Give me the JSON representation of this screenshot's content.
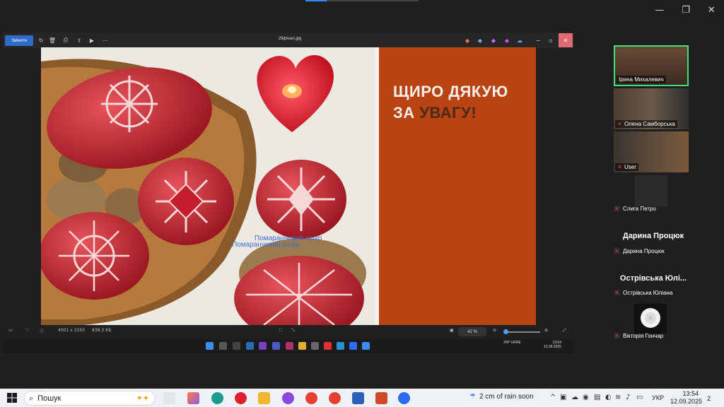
{
  "window_controls": {
    "minimize": "—",
    "restore": "❐",
    "close": "✕"
  },
  "photos_app": {
    "open_button": "Змінити",
    "file_name": "29фінал.jpg",
    "bottom": {
      "dimensions": "4001 x 2250",
      "file_size": "838.3 КБ",
      "zoom": "42 %"
    },
    "inner_taskbar": {
      "lang": "УКР UKRE",
      "time": "13:54",
      "date": "12.09.2025"
    }
  },
  "slide": {
    "line1": "ЩИРО ДЯКУЮ",
    "line2_a": "ЗА",
    "line2_b": "УВАГУ!",
    "overlay_text": "Помаранчевий колір"
  },
  "participants": [
    {
      "name": "Ірина Михалевич",
      "type": "video"
    },
    {
      "name": "Олена Самборська",
      "type": "video"
    },
    {
      "name": "User",
      "type": "video"
    },
    {
      "name": "Слига Петро",
      "type": "photo"
    },
    {
      "name": "Дарина Процюк",
      "display_name": "Дарина Процюк",
      "type": "name"
    },
    {
      "name": "Острівська Юліана",
      "display_name": "Острівська Юлі...",
      "type": "name"
    },
    {
      "name": "Вікторія Гончар",
      "type": "photo"
    }
  ],
  "taskbar": {
    "search_placeholder": "Пошук",
    "weather": "2 cm of rain soon",
    "lang": "УКР",
    "time": "13:54",
    "date": "12.09.2025",
    "notifications": "2"
  },
  "colors": {
    "slide_orange": "#b94312",
    "accent_word": "#4b2a1a",
    "active_speaker": "#3ce17a",
    "zoom_blue": "#2d8cff"
  }
}
